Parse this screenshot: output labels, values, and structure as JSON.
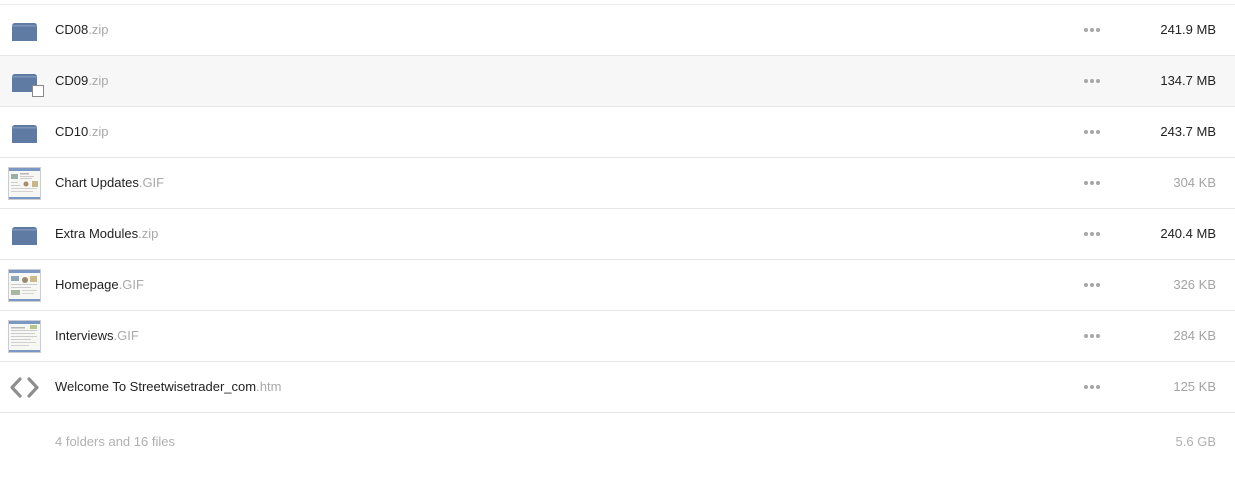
{
  "files": [
    {
      "name": "CD08",
      "ext": ".zip",
      "size": "241.9 MB",
      "icon": "archive-icon",
      "size_emphasis": true
    },
    {
      "name": "CD09",
      "ext": ".zip",
      "size": "134.7 MB",
      "icon": "archive-icon",
      "size_emphasis": true,
      "selected": true
    },
    {
      "name": "CD10",
      "ext": ".zip",
      "size": "243.7 MB",
      "icon": "archive-icon",
      "size_emphasis": true
    },
    {
      "name": "Chart Updates",
      "ext": ".GIF",
      "size": "304 KB",
      "icon": "image-thumbnail-icon",
      "size_emphasis": false
    },
    {
      "name": "Extra Modules",
      "ext": ".zip",
      "size": "240.4 MB",
      "icon": "archive-icon",
      "size_emphasis": true
    },
    {
      "name": "Homepage",
      "ext": ".GIF",
      "size": "326 KB",
      "icon": "image-thumbnail-icon",
      "size_emphasis": false
    },
    {
      "name": "Interviews",
      "ext": ".GIF",
      "size": "284 KB",
      "icon": "image-thumbnail-icon",
      "size_emphasis": false
    },
    {
      "name": "Welcome To Streetwisetrader_com",
      "ext": ".htm",
      "size": "125 KB",
      "icon": "code-icon",
      "size_emphasis": false
    }
  ],
  "summary": {
    "count": "4 folders and 16 files",
    "total": "5.6 GB"
  },
  "colors": {
    "archive_icon": "#5f7aa3",
    "muted_text": "#a9a9a9",
    "hover_row": "#f7f7f7"
  }
}
